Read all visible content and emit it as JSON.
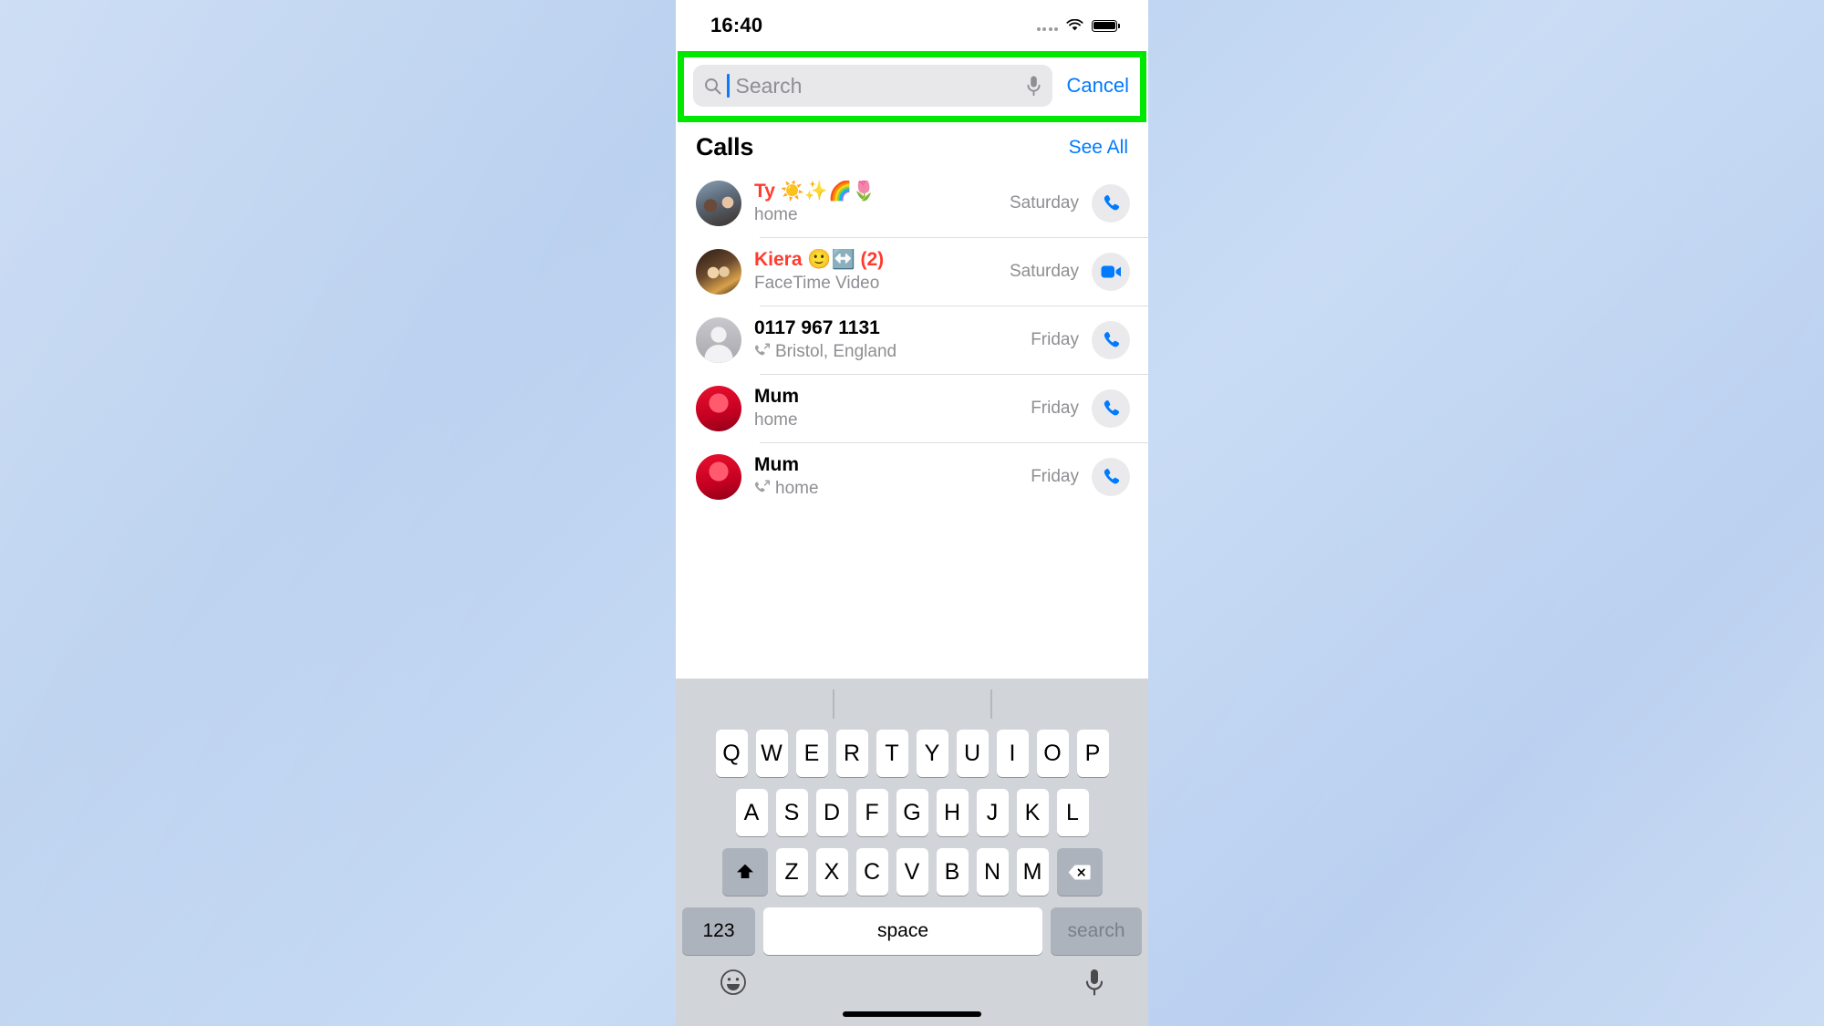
{
  "status_bar": {
    "time": "16:40",
    "signal_icon": "signal-dots-icon",
    "wifi_icon": "wifi-icon",
    "battery_icon": "battery-full-icon"
  },
  "search": {
    "placeholder": "Search",
    "value": "",
    "search_icon": "magnifier-icon",
    "dictation_icon": "microphone-icon",
    "cancel_label": "Cancel",
    "highlight_color": "#00e800"
  },
  "calls_section": {
    "title": "Calls",
    "see_all_label": "See All",
    "rows": [
      {
        "name": "Ty ☀️✨🌈🌷",
        "missed": true,
        "detail": "home",
        "outgoing": false,
        "when": "Saturday",
        "action_icon": "phone-icon",
        "avatar": "photo-couple-avatar"
      },
      {
        "name": "Kiera 🙂↔️ (2)",
        "missed": true,
        "detail": "FaceTime Video",
        "outgoing": false,
        "when": "Saturday",
        "action_icon": "video-camera-icon",
        "avatar": "photo-two-women-avatar"
      },
      {
        "name": "0117 967 1131",
        "missed": false,
        "detail": "Bristol, England",
        "outgoing": true,
        "when": "Friday",
        "action_icon": "phone-icon",
        "avatar": "generic-person-avatar"
      },
      {
        "name": "Mum",
        "missed": false,
        "detail": "home",
        "outgoing": false,
        "when": "Friday",
        "action_icon": "phone-icon",
        "avatar": "photo-red-avatar"
      },
      {
        "name": "Mum",
        "missed": false,
        "detail": "home",
        "outgoing": true,
        "when": "Friday",
        "action_icon": "phone-icon",
        "avatar": "photo-red-avatar"
      }
    ]
  },
  "keyboard": {
    "row1": [
      "Q",
      "W",
      "E",
      "R",
      "T",
      "Y",
      "U",
      "I",
      "O",
      "P"
    ],
    "row2": [
      "A",
      "S",
      "D",
      "F",
      "G",
      "H",
      "J",
      "K",
      "L"
    ],
    "row3": [
      "Z",
      "X",
      "C",
      "V",
      "B",
      "N",
      "M"
    ],
    "shift_icon": "shift-arrow-icon",
    "backspace_icon": "backspace-icon",
    "numbers_label": "123",
    "space_label": "space",
    "return_label": "search",
    "emoji_icon": "smiley-face-icon",
    "dictation_icon": "microphone-icon"
  }
}
